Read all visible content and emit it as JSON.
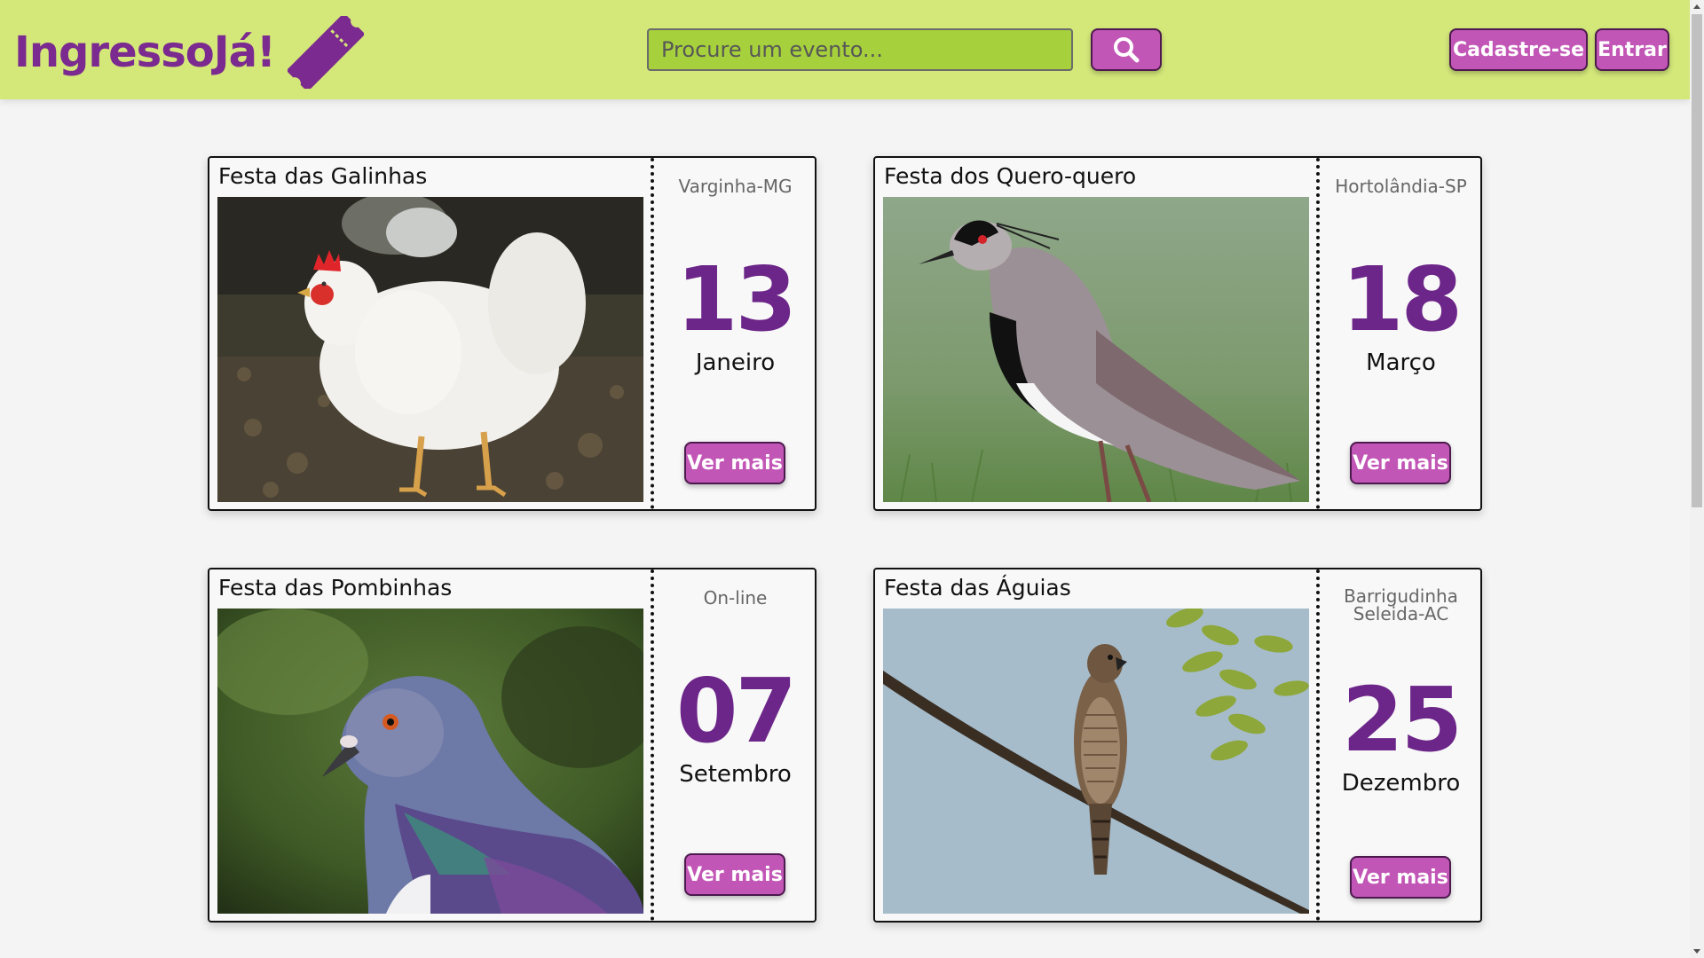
{
  "header": {
    "logo_text": "IngressoJá!",
    "logo_icon": "ticket-icon",
    "search_placeholder": "Procure um evento...",
    "search_icon": "magnifier-icon",
    "signup_label": "Cadastre-se",
    "login_label": "Entrar",
    "colors": {
      "header_bg": "#d4e87a",
      "accent": "#c256b6",
      "logo": "#7b2a8f",
      "search_bg": "#a6d13c"
    }
  },
  "events": [
    {
      "title": "Festa das Galinhas",
      "image": "white-hen-photo",
      "location": "Varginha-MG",
      "day": "13",
      "month": "Janeiro",
      "button_label": "Ver mais"
    },
    {
      "title": "Festa dos Quero-quero",
      "image": "southern-lapwing-photo",
      "location": "Hortolândia-SP",
      "day": "18",
      "month": "Março",
      "button_label": "Ver mais"
    },
    {
      "title": "Festa das Pombinhas",
      "image": "pigeon-photo",
      "location": "On-line",
      "day": "07",
      "month": "Setembro",
      "button_label": "Ver mais"
    },
    {
      "title": "Festa das Águias",
      "image": "hawk-on-branch-photo",
      "location_line1": "Barrigudinha",
      "location_line2": "Seleida-AC",
      "day": "25",
      "month": "Dezembro",
      "button_label": "Ver mais"
    }
  ],
  "date_color": "#6c2588"
}
